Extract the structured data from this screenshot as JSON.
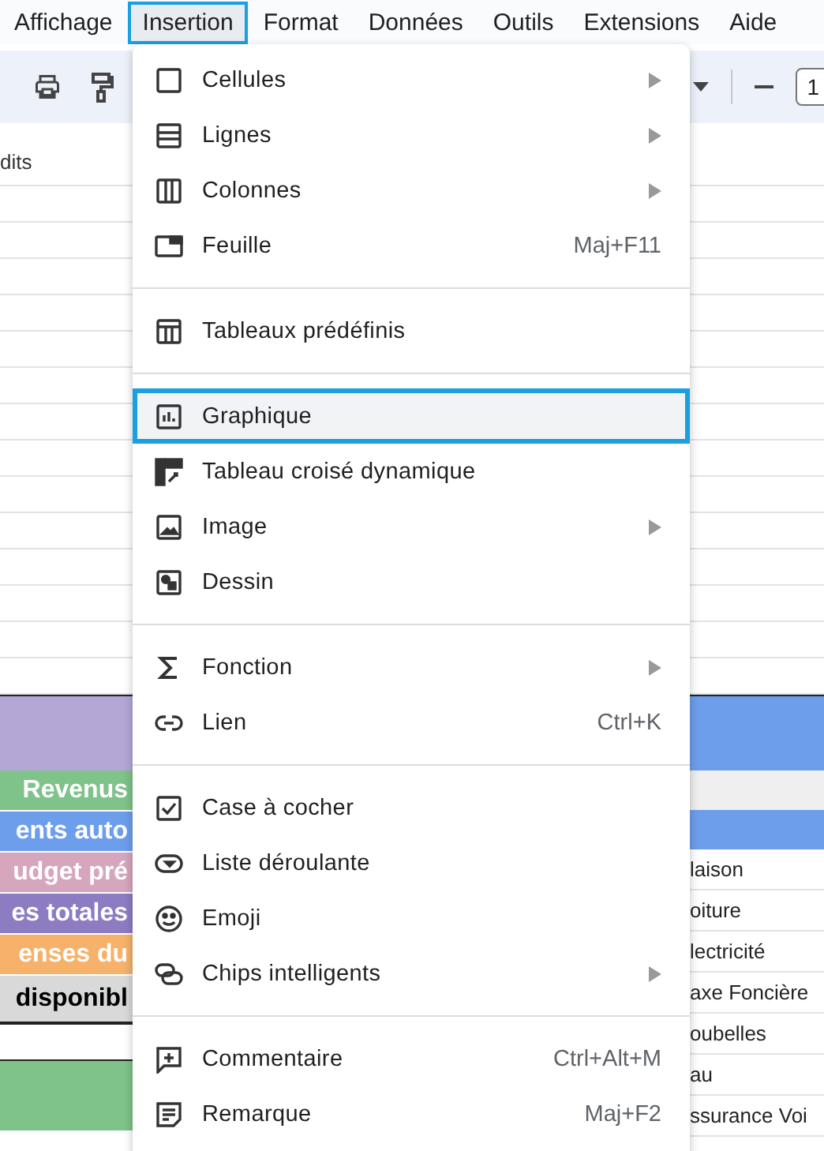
{
  "menubar": [
    {
      "label": "Affichage",
      "selected": false
    },
    {
      "label": "Insertion",
      "selected": true
    },
    {
      "label": "Format",
      "selected": false
    },
    {
      "label": "Données",
      "selected": false
    },
    {
      "label": "Outils",
      "selected": false
    },
    {
      "label": "Extensions",
      "selected": false
    },
    {
      "label": "Aide",
      "selected": false
    }
  ],
  "toolbar": {
    "font_size": "1"
  },
  "sheet_left": {
    "top_cell": "dits",
    "rows": [
      {
        "text": "Revenus",
        "color": "#7fc28a"
      },
      {
        "text": "ents auto",
        "color": "#6d9eeb"
      },
      {
        "text": "udget pré",
        "color": "#d5a6bd"
      },
      {
        "text": "es totales",
        "color": "#8e7cc3"
      },
      {
        "text": "enses du",
        "color": "#f6b26b"
      },
      {
        "text": "disponibl",
        "color": "#d9d9d9"
      }
    ]
  },
  "sheet_right": {
    "rows": [
      "laison",
      "oiture",
      "lectricité",
      "axe Foncière",
      "oubelles",
      "au",
      "ssurance Voi"
    ]
  },
  "menu": {
    "sections": [
      [
        {
          "kind": "cells",
          "label": "Cellules",
          "submenu": true,
          "selected": false
        },
        {
          "kind": "rows",
          "label": "Lignes",
          "submenu": true,
          "selected": false
        },
        {
          "kind": "columns",
          "label": "Colonnes",
          "submenu": true,
          "selected": false
        },
        {
          "kind": "sheet",
          "label": "Feuille",
          "shortcut": "Maj+F11",
          "submenu": false,
          "selected": false
        }
      ],
      [
        {
          "kind": "table",
          "label": "Tableaux prédéfinis",
          "submenu": false,
          "selected": false
        }
      ],
      [
        {
          "kind": "chart",
          "label": "Graphique",
          "submenu": false,
          "selected": true
        },
        {
          "kind": "pivot",
          "label": "Tableau croisé dynamique",
          "submenu": false,
          "selected": false
        },
        {
          "kind": "image",
          "label": "Image",
          "submenu": true,
          "selected": false
        },
        {
          "kind": "drawing",
          "label": "Dessin",
          "submenu": false,
          "selected": false
        }
      ],
      [
        {
          "kind": "sigma",
          "label": "Fonction",
          "submenu": true,
          "selected": false
        },
        {
          "kind": "link",
          "label": "Lien",
          "shortcut": "Ctrl+K",
          "submenu": false,
          "selected": false
        }
      ],
      [
        {
          "kind": "checkbox",
          "label": "Case à cocher",
          "submenu": false,
          "selected": false
        },
        {
          "kind": "dropdown",
          "label": "Liste déroulante",
          "submenu": false,
          "selected": false
        },
        {
          "kind": "emoji",
          "label": "Emoji",
          "submenu": false,
          "selected": false
        },
        {
          "kind": "chips",
          "label": "Chips intelligents",
          "submenu": true,
          "selected": false
        }
      ],
      [
        {
          "kind": "comment",
          "label": "Commentaire",
          "shortcut": "Ctrl+Alt+M",
          "submenu": false,
          "selected": false
        },
        {
          "kind": "note",
          "label": "Remarque",
          "shortcut": "Maj+F2",
          "submenu": false,
          "selected": false
        }
      ]
    ]
  }
}
